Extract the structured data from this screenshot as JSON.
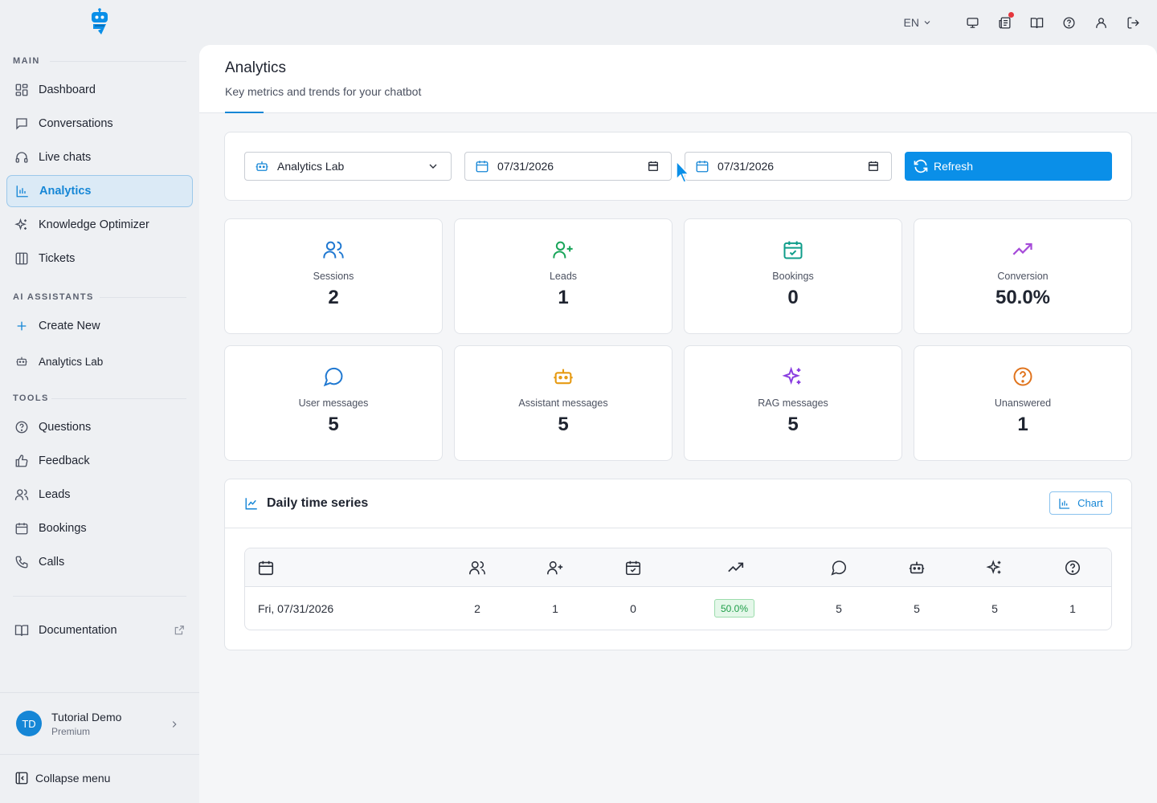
{
  "sidebar": {
    "sections": {
      "main": "MAIN",
      "ai": "AI ASSISTANTS",
      "tools": "TOOLS"
    },
    "main_items": [
      {
        "label": "Dashboard",
        "icon": "dashboard-icon"
      },
      {
        "label": "Conversations",
        "icon": "chat-icon"
      },
      {
        "label": "Live chats",
        "icon": "headset-icon"
      },
      {
        "label": "Analytics",
        "icon": "bar-chart-icon",
        "active": true
      },
      {
        "label": "Knowledge Optimizer",
        "icon": "sparkles-icon"
      },
      {
        "label": "Tickets",
        "icon": "columns-icon"
      }
    ],
    "ai_items": [
      {
        "label": "Create New",
        "icon": "plus-icon"
      },
      {
        "label": "Analytics Lab",
        "icon": "bot-icon"
      }
    ],
    "tool_items": [
      {
        "label": "Questions",
        "icon": "help-circle-icon"
      },
      {
        "label": "Feedback",
        "icon": "thumbs-up-icon"
      },
      {
        "label": "Leads",
        "icon": "users-icon"
      },
      {
        "label": "Bookings",
        "icon": "calendar-icon"
      },
      {
        "label": "Calls",
        "icon": "phone-icon"
      }
    ],
    "documentation": "Documentation",
    "user": {
      "initials": "TD",
      "name": "Tutorial Demo",
      "plan": "Premium"
    },
    "collapse": "Collapse menu"
  },
  "topbar": {
    "language": "EN"
  },
  "page": {
    "title": "Analytics",
    "subtitle": "Key metrics and trends for your chatbot"
  },
  "filters": {
    "assistant": "Analytics Lab",
    "start_date": "07/31/2026",
    "end_date": "07/31/2026",
    "refresh_label": "Refresh"
  },
  "stats": [
    {
      "label": "Sessions",
      "value": "2",
      "icon": "users-icon",
      "color": "#1f78d1"
    },
    {
      "label": "Leads",
      "value": "1",
      "icon": "user-plus-icon",
      "color": "#19a55a"
    },
    {
      "label": "Bookings",
      "value": "0",
      "icon": "calendar-check-icon",
      "color": "#0f9d8a"
    },
    {
      "label": "Conversion",
      "value": "50.0%",
      "icon": "trending-up-icon",
      "color": "#a64bd9"
    },
    {
      "label": "User messages",
      "value": "5",
      "icon": "message-circle-icon",
      "color": "#1f78d1"
    },
    {
      "label": "Assistant messages",
      "value": "5",
      "icon": "bot-icon",
      "color": "#e69a12"
    },
    {
      "label": "RAG messages",
      "value": "5",
      "icon": "sparkles-icon",
      "color": "#8a3fe0"
    },
    {
      "label": "Unanswered",
      "value": "1",
      "icon": "help-circle-icon",
      "color": "#e0731c"
    }
  ],
  "timeseries": {
    "title": "Daily time series",
    "chart_button": "Chart",
    "row": {
      "date": "Fri, 07/31/2026",
      "sessions": "2",
      "leads": "1",
      "bookings": "0",
      "conversion": "50.0%",
      "user_messages": "5",
      "assistant_messages": "5",
      "rag_messages": "5",
      "unanswered": "1"
    }
  }
}
